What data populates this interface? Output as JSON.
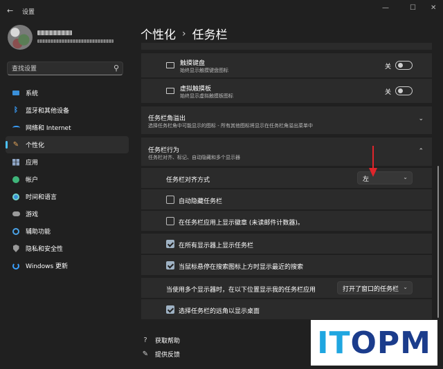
{
  "window": {
    "title": "设置",
    "back_glyph": "←",
    "minimize_glyph": "—",
    "maximize_glyph": "☐",
    "close_glyph": "✕"
  },
  "search": {
    "placeholder": "查找设置",
    "icon_glyph": "⚲"
  },
  "sidebar": {
    "items": [
      {
        "label": "系统",
        "icon": "system-icon"
      },
      {
        "label": "蓝牙和其他设备",
        "icon": "bluetooth-icon"
      },
      {
        "label": "网络和 Internet",
        "icon": "network-icon"
      },
      {
        "label": "个性化",
        "icon": "brush-icon",
        "active": true
      },
      {
        "label": "应用",
        "icon": "apps-icon"
      },
      {
        "label": "帐户",
        "icon": "account-icon"
      },
      {
        "label": "时间和语言",
        "icon": "globe-icon"
      },
      {
        "label": "游戏",
        "icon": "gamepad-icon"
      },
      {
        "label": "辅助功能",
        "icon": "accessibility-icon"
      },
      {
        "label": "隐私和安全性",
        "icon": "shield-icon"
      },
      {
        "label": "Windows 更新",
        "icon": "update-icon"
      }
    ]
  },
  "breadcrumb": {
    "parent": "个性化",
    "separator": "›",
    "current": "任务栏"
  },
  "pen_menu": {
    "rows": [
      {
        "title": "触摸键盘",
        "desc": "始终显示触摸键盘图标",
        "toggle_label": "关",
        "on": false
      },
      {
        "title": "虚拟触摸板",
        "desc": "始终显示虚拟触摸板图标",
        "toggle_label": "关",
        "on": false
      }
    ]
  },
  "overflow_section": {
    "title": "任务栏角溢出",
    "desc": "选择任务栏角中可能显示的图标 - 所有其他图标将显示在任务栏角溢出菜单中",
    "chevron": "⌄"
  },
  "behaviors_section": {
    "title": "任务栏行为",
    "desc": "任务栏对齐、标记、自动隐藏和多个显示器",
    "chevron": "⌃",
    "alignment": {
      "label": "任务栏对齐方式",
      "value": "左",
      "chevron": "⌄"
    },
    "options": [
      {
        "label": "自动隐藏任务栏",
        "checked": false
      },
      {
        "label": "在任务栏应用上显示徽章 (未读邮件计数器)。",
        "checked": false
      },
      {
        "label": "在所有显示器上显示任务栏",
        "checked": true
      },
      {
        "label": "当鼠标悬停在搜索图标上方时显示最近的搜索",
        "checked": true
      }
    ],
    "multi_display": {
      "label": "当使用多个显示器时，在以下位置显示我的任务栏应用",
      "value": "打开了窗口的任务栏",
      "chevron": "⌄"
    },
    "show_desktop": {
      "label": "选择任务栏的远角以显示桌面",
      "checked": true
    }
  },
  "footer": {
    "help": {
      "label": "获取帮助",
      "icon_glyph": "?"
    },
    "feedback": {
      "label": "提供反馈",
      "icon_glyph": "✎"
    }
  },
  "watermark": {
    "text_part1": "IT",
    "text_part2": "OPM",
    "color1": "#1fa6e0",
    "color2": "#1b3c8c"
  },
  "colors": {
    "accent": "#4cc2ff",
    "background": "#202020",
    "card": "#2b2b2b",
    "annotation_arrow": "#e0252b"
  }
}
